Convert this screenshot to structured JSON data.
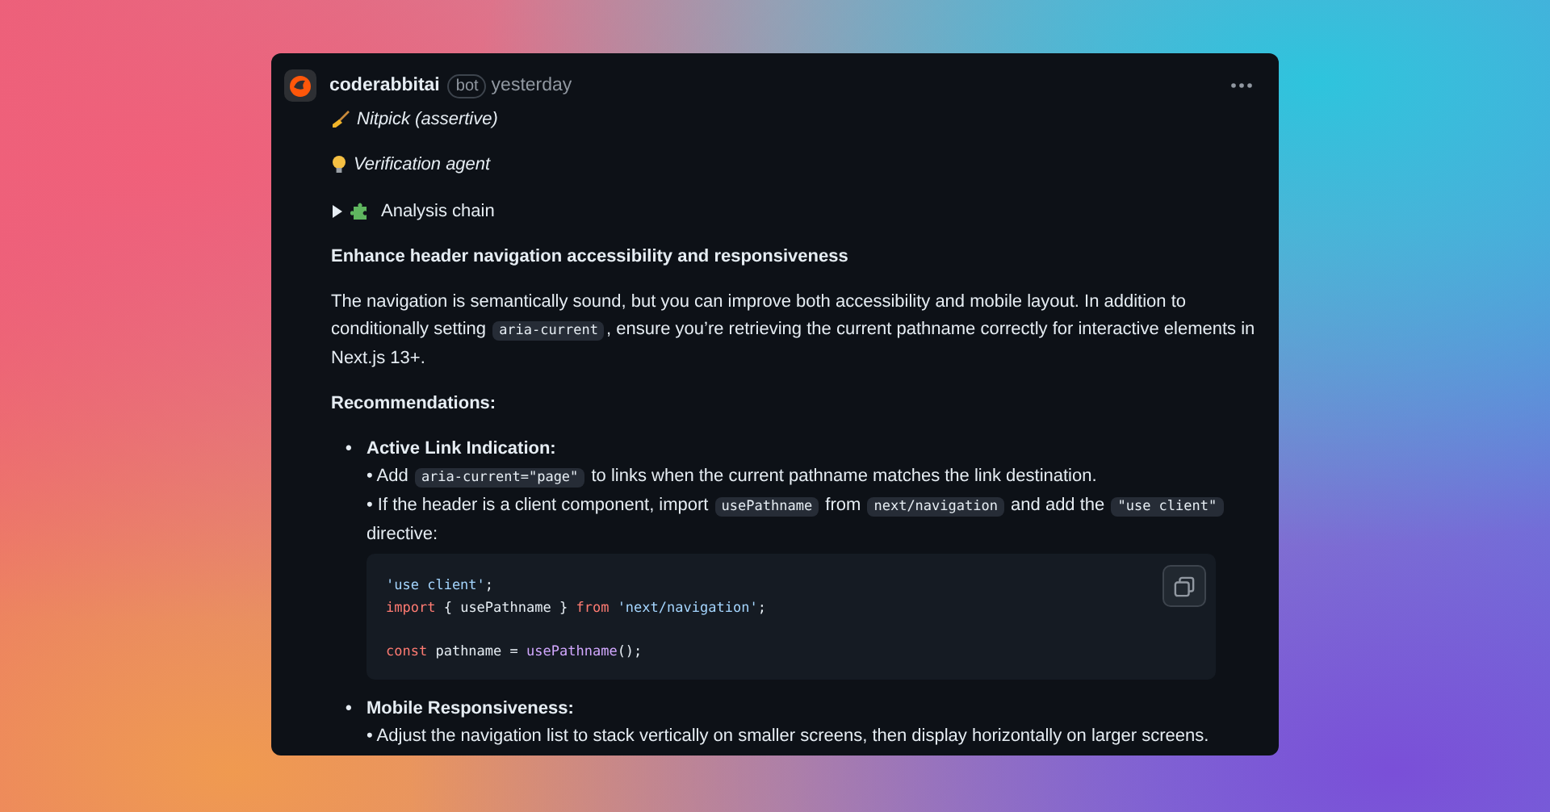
{
  "comment": {
    "author": "coderabbitai",
    "badge": "bot",
    "time": "yesterday"
  },
  "labels": [
    {
      "kind": "broom",
      "text": "Nitpick (assertive)"
    },
    {
      "kind": "bulb",
      "text": "Verification agent"
    }
  ],
  "details": {
    "summary": "Analysis chain",
    "expanded": false
  },
  "heading": "Enhance header navigation accessibility and responsiveness",
  "paragraph": [
    {
      "kind": "text",
      "text": "The navigation is semantically sound, but you can improve both accessibility and mobile layout. In addition to conditionally setting "
    },
    {
      "kind": "code",
      "text": "aria-current"
    },
    {
      "kind": "text",
      "text": ", ensure you’re retrieving the current pathname correctly for interactive elements in Next.js 13+."
    }
  ],
  "subheading": "Recommendations:",
  "recommendations": [
    {
      "marker": "•",
      "title": "Active Link Indication:",
      "lines": [
        [
          {
            "kind": "text",
            "text": "• Add "
          },
          {
            "kind": "code",
            "text": "aria-current=\"page\""
          },
          {
            "kind": "text",
            "text": " to links when the current pathname matches the link destination."
          }
        ],
        [
          {
            "kind": "text",
            "text": "• If the header is a client component, import "
          },
          {
            "kind": "code",
            "text": "usePathname"
          },
          {
            "kind": "text",
            "text": " from "
          },
          {
            "kind": "code",
            "text": "next/navigation"
          },
          {
            "kind": "text",
            "text": " and add the "
          },
          {
            "kind": "code",
            "text": "\"use client\""
          },
          {
            "kind": "text",
            "text": " directive:"
          }
        ]
      ],
      "code_block": [
        {
          "tokens": [
            {
              "kind": "string",
              "text": "'use client'"
            },
            {
              "kind": "plain",
              "text": ";"
            }
          ]
        },
        {
          "tokens": [
            {
              "kind": "keyword",
              "text": "import"
            },
            {
              "kind": "plain",
              "text": " { usePathname } "
            },
            {
              "kind": "keyword",
              "text": "from "
            },
            {
              "kind": "string",
              "text": "'next/navigation'"
            },
            {
              "kind": "plain",
              "text": ";"
            }
          ]
        },
        {
          "gap_before": true,
          "tokens": [
            {
              "kind": "keyword",
              "text": "const"
            },
            {
              "kind": "plain",
              "text": " pathname = "
            },
            {
              "kind": "func",
              "text": "usePathname"
            },
            {
              "kind": "plain",
              "text": "();"
            }
          ]
        }
      ]
    },
    {
      "marker": "•",
      "title": "Mobile Responsiveness:",
      "lines": [
        [
          {
            "kind": "text",
            "text": "• Adjust the navigation list to stack vertically on smaller screens, then display horizontally on larger screens."
          }
        ]
      ]
    }
  ]
}
